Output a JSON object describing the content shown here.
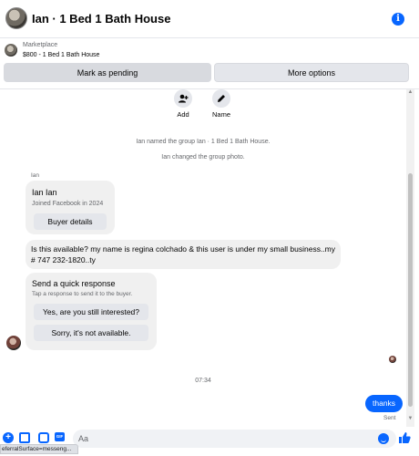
{
  "header": {
    "title": "Ian · 1 Bed 1 Bath House"
  },
  "marketplace": {
    "label": "Marketplace",
    "item": "$800 - 1 Bed 1 Bath House",
    "pending_label": "Mark as pending",
    "more_label": "More options"
  },
  "quick_actions": [
    {
      "label": "Add",
      "icon": "add-user-icon"
    },
    {
      "label": "Name",
      "icon": "pencil-icon"
    }
  ],
  "system_messages": [
    "Ian named the group Ian · 1 Bed 1 Bath House.",
    "Ian changed the group photo."
  ],
  "buyer_card": {
    "sender": "Ian",
    "name": "Ian Ian",
    "joined": "Joined Facebook in 2024",
    "button": "Buyer details"
  },
  "incoming_message": "Is this available?  my name is regina colchado &  this user is under my small business..my # 747 232-1820..ty",
  "quick_response": {
    "title": "Send a quick response",
    "subtitle": "Tap a response to send it to the buyer.",
    "options": [
      "Yes, are you still interested?",
      "Sorry, it's not available."
    ]
  },
  "timestamp": "07:34",
  "outgoing_message": "thanks",
  "delivery_status": "Sent",
  "composer": {
    "placeholder": "Aa"
  },
  "status_bar": "eferralSurface=messeng...",
  "colors": {
    "accent": "#0866ff",
    "bubble_gray": "#f0f0f0",
    "button_gray": "#e4e6eb"
  }
}
